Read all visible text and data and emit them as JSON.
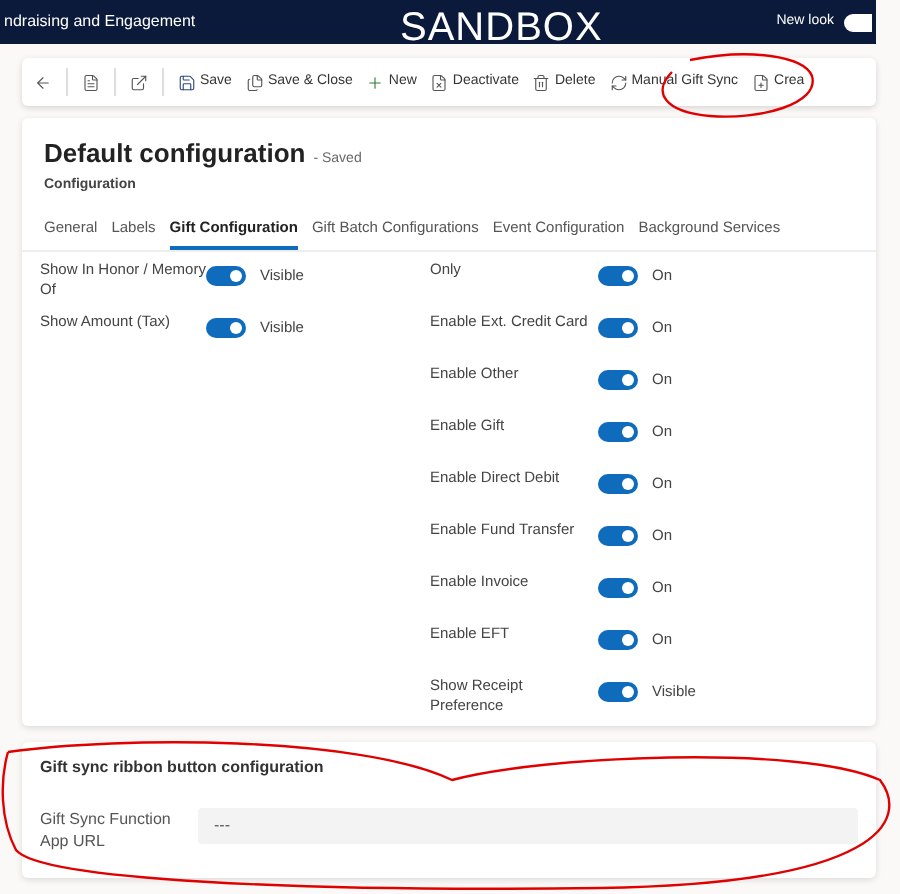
{
  "header": {
    "app_title": "ndraising and Engagement",
    "environment": "SANDBOX",
    "new_look": {
      "label": "New look",
      "on": true
    }
  },
  "toolbar": [
    {
      "kind": "back"
    },
    {
      "kind": "page"
    },
    {
      "kind": "popout"
    },
    {
      "kind": "save",
      "label": "Save"
    },
    {
      "kind": "saveclose",
      "label": "Save & Close"
    },
    {
      "kind": "new",
      "label": "New"
    },
    {
      "kind": "deactivate",
      "label": "Deactivate"
    },
    {
      "kind": "delete",
      "label": "Delete"
    },
    {
      "kind": "sync",
      "label": "Manual Gift Sync"
    },
    {
      "kind": "create",
      "label": "Crea"
    }
  ],
  "record": {
    "title": "Default configuration",
    "status": "- Saved",
    "entity": "Configuration"
  },
  "tabs": [
    {
      "label": "General",
      "selected": false
    },
    {
      "label": "Labels",
      "selected": false
    },
    {
      "label": "Gift Configuration",
      "selected": true
    },
    {
      "label": "Gift Batch Configurations",
      "selected": false
    },
    {
      "label": "Event Configuration",
      "selected": false
    },
    {
      "label": "Background Services",
      "selected": false
    }
  ],
  "left_fields": [
    {
      "label": "Show In Honor / Memory Of",
      "on": true,
      "value": "Visible"
    },
    {
      "label": "Show Amount (Tax)",
      "on": true,
      "value": "Visible"
    }
  ],
  "right_fields": [
    {
      "label": "Only",
      "on": true,
      "value": "On"
    },
    {
      "label": "Enable Ext. Credit Card",
      "on": true,
      "value": "On"
    },
    {
      "label": "Enable Other",
      "on": true,
      "value": "On"
    },
    {
      "label": "Enable Gift",
      "on": true,
      "value": "On"
    },
    {
      "label": "Enable Direct Debit",
      "on": true,
      "value": "On"
    },
    {
      "label": "Enable Fund Transfer",
      "on": true,
      "value": "On"
    },
    {
      "label": "Enable Invoice",
      "on": true,
      "value": "On"
    },
    {
      "label": "Enable EFT",
      "on": true,
      "value": "On"
    },
    {
      "label": "Show Receipt Preference",
      "on": true,
      "value": "Visible"
    }
  ],
  "sync_section": {
    "title": "Gift sync ribbon button configuration",
    "field": {
      "label": "Gift Sync Function App URL",
      "value": "---"
    }
  }
}
